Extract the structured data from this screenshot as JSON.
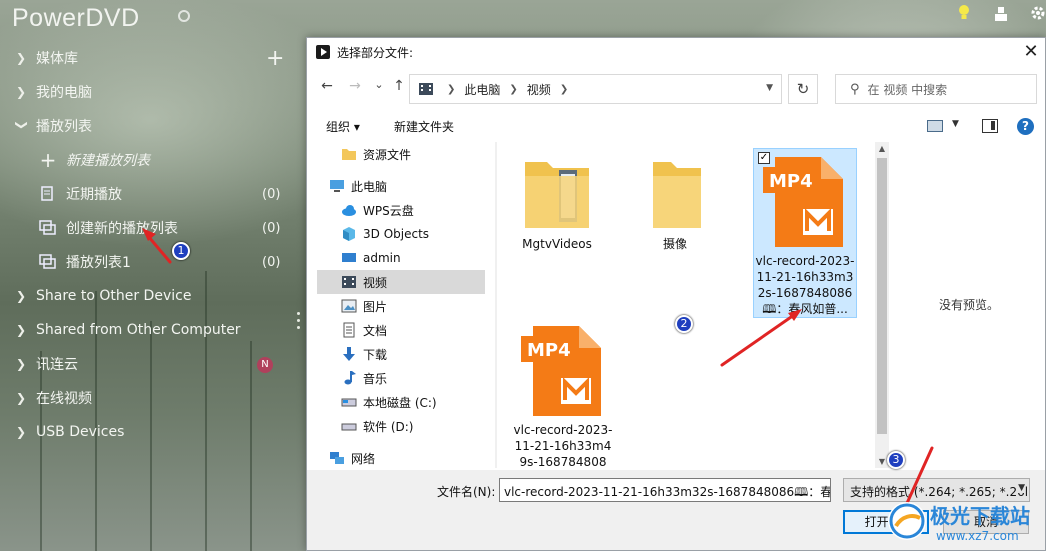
{
  "app": {
    "title": "PowerDVD",
    "sidebar": {
      "media_library": "媒体库",
      "my_computer": "我的电脑",
      "playlists": "播放列表",
      "new_playlist": "新建播放列表",
      "recent": {
        "label": "近期播放",
        "count": "(0)"
      },
      "created_playlist": {
        "label": "创建新的播放列表",
        "count": "(0)"
      },
      "playlist1": {
        "label": "播放列表1",
        "count": "(0)"
      },
      "share_to_other": "Share to Other Device",
      "shared_from_other": "Shared from Other Computer",
      "xunlianyun": "讯连云",
      "xunlianyun_badge": "N",
      "online_video": "在线视频",
      "usb_devices": "USB Devices"
    }
  },
  "dialog": {
    "title": "选择部分文件:",
    "close_glyph": "✕",
    "nav": {
      "back": "←",
      "forward": "→",
      "recent": "⌄",
      "up": "↑",
      "refresh": "↻"
    },
    "breadcrumb": [
      "此电脑",
      "视频"
    ],
    "search_placeholder": "在 视频 中搜索",
    "toolbar": {
      "organize": "组织 ▾",
      "new_folder": "新建文件夹",
      "help": "?"
    },
    "tree": [
      {
        "label": "资源文件",
        "icon": "folder-icon"
      },
      {
        "label": "此电脑",
        "icon": "computer-icon"
      },
      {
        "label": "WPS云盘",
        "icon": "cloud-icon"
      },
      {
        "label": "3D Objects",
        "icon": "cube-icon"
      },
      {
        "label": "admin",
        "icon": "desktop-icon"
      },
      {
        "label": "视频",
        "icon": "video-folder-icon",
        "selected": true
      },
      {
        "label": "图片",
        "icon": "picture-folder-icon"
      },
      {
        "label": "文档",
        "icon": "document-folder-icon"
      },
      {
        "label": "下载",
        "icon": "download-icon"
      },
      {
        "label": "音乐",
        "icon": "music-icon"
      },
      {
        "label": "本地磁盘 (C:)",
        "icon": "drive-icon"
      },
      {
        "label": "软件 (D:)",
        "icon": "drive-icon"
      },
      {
        "label": "网络",
        "icon": "network-icon"
      }
    ],
    "files": [
      {
        "name": "MgtvVideos",
        "type": "folder"
      },
      {
        "name": "摄像",
        "type": "folder"
      },
      {
        "name": "vlc-record-2023-11-21-16h33m32s-1687848086🕮：春风如普...",
        "type": "mp4",
        "selected": true,
        "badge": "MP4"
      },
      {
        "name": "vlc-record-2023-11-21-16h33m49s-168784808",
        "type": "mp4",
        "badge": "MP4"
      }
    ],
    "no_preview": "没有预览。",
    "filename_label": "文件名(N):",
    "filename_value": "vlc-record-2023-11-21-16h33m32s-1687848086🕮：春",
    "file_type": "支持的格式 (*.264; *.265; *.26l",
    "open_label": "打开(O)",
    "cancel_label": "取消"
  },
  "annotations": {
    "step1": "1",
    "step2": "2",
    "step3": "3"
  },
  "watermark": {
    "text": "极光下载站",
    "url": "www.xz7.com"
  },
  "colors": {
    "accent_arrow": "#e02424",
    "step_badge": "#1f3fbf",
    "selection": "#cce8ff",
    "mp4_orange": "#f47b16"
  }
}
